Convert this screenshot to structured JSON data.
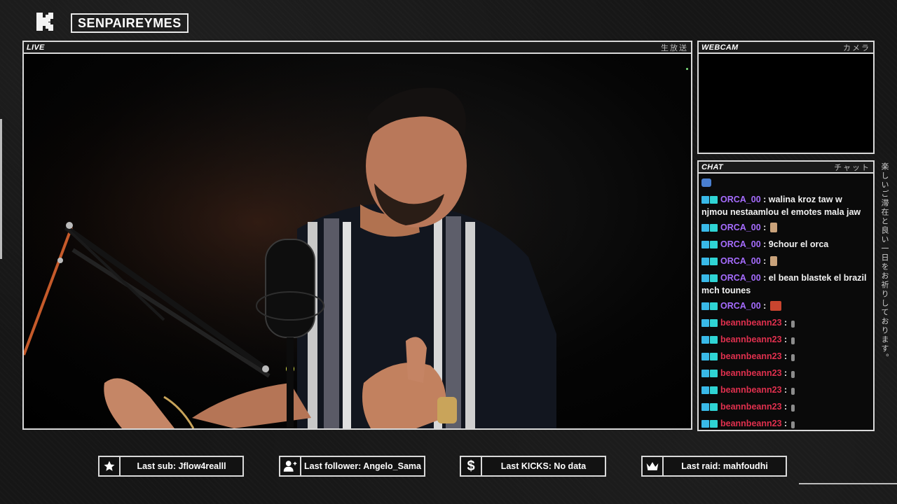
{
  "header": {
    "channel_name": "SENPAIREYMES"
  },
  "live": {
    "title": "LIVE",
    "jp_label": "生放送"
  },
  "webcam": {
    "title": "WEBCAM",
    "jp_label": "カメラ"
  },
  "chat": {
    "title": "CHAT",
    "jp_label": "チャット",
    "messages": [
      {
        "user": "ORCA_00",
        "text": ": walina kroz taw w njmou nestaamlou el emotes mala jaw",
        "emote": ""
      },
      {
        "user": "ORCA_00",
        "text": ":",
        "emote": "peach"
      },
      {
        "user": "ORCA_00",
        "text": ": 9chour el orca",
        "emote": ""
      },
      {
        "user": "ORCA_00",
        "text": ":",
        "emote": "peach"
      },
      {
        "user": "ORCA_00",
        "text": ": el bean blastek el brazil mch tounes",
        "emote": ""
      },
      {
        "user": "ORCA_00",
        "text": ":",
        "emote": "red"
      },
      {
        "user": "beannbeann23",
        "text": ":",
        "emote": "small"
      },
      {
        "user": "beannbeann23",
        "text": ":",
        "emote": "small"
      },
      {
        "user": "beannbeann23",
        "text": ":",
        "emote": "small"
      },
      {
        "user": "beannbeann23",
        "text": ":",
        "emote": "small"
      },
      {
        "user": "beannbeann23",
        "text": ":",
        "emote": "small"
      },
      {
        "user": "beannbeann23",
        "text": ":",
        "emote": "small"
      },
      {
        "user": "beannbeann23",
        "text": ":",
        "emote": "small"
      }
    ]
  },
  "side_text": "楽しいご滞在と良い一日をお祈りしております。",
  "stats": {
    "last_sub": "Last sub: Jflow4realll",
    "last_follower": "Last follower: Angelo_Sama",
    "last_kicks": "Last KICKS: No data",
    "last_raid": "Last raid: mahfoudhi"
  },
  "icons": {
    "logo": "kick-logo-icon",
    "sub": "star-icon",
    "follower": "user-plus-icon",
    "kicks": "dollar-icon",
    "raid": "crown-icon"
  },
  "colors": {
    "orca_user": "#a66cff",
    "bean_user": "#e0304e",
    "badge": "#39b9e8"
  }
}
